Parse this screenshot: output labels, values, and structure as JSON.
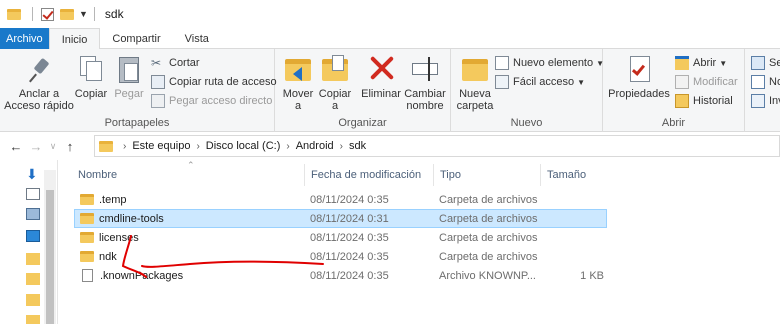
{
  "window": {
    "title": "sdk"
  },
  "tabs": [
    {
      "label": "Archivo"
    },
    {
      "label": "Inicio"
    },
    {
      "label": "Compartir"
    },
    {
      "label": "Vista"
    }
  ],
  "ribbon": {
    "portapapeles": {
      "label": "Portapapeles",
      "anclar": "Anclar a\nAcceso rápido",
      "anclar_l1": "Anclar a",
      "anclar_l2": "Acceso rápido",
      "copiar": "Copiar",
      "pegar": "Pegar",
      "cortar": "Cortar",
      "copiar_ruta": "Copiar ruta de acceso",
      "pegar_acceso": "Pegar acceso directo"
    },
    "organizar": {
      "label": "Organizar",
      "mover_l1": "Mover",
      "mover_l2": "a",
      "copiar_l1": "Copiar",
      "copiar_l2": "a",
      "eliminar": "Eliminar",
      "cambiar_l1": "Cambiar",
      "cambiar_l2": "nombre"
    },
    "nuevo": {
      "label": "Nuevo",
      "nueva_l1": "Nueva",
      "nueva_l2": "carpeta",
      "nuevo_elemento": "Nuevo elemento",
      "facil_acceso": "Fácil acceso"
    },
    "abrir": {
      "label": "Abrir",
      "propiedades": "Propiedades",
      "abrir": "Abrir",
      "modificar": "Modificar",
      "historial": "Historial"
    },
    "seleccionar": {
      "sel1": "Sel",
      "sel2": "No",
      "sel3": "Inv"
    }
  },
  "address": {
    "crumbs": [
      "Este equipo",
      "Disco local (C:)",
      "Android",
      "sdk"
    ]
  },
  "columns": {
    "name": "Nombre",
    "date": "Fecha de modificación",
    "type": "Tipo",
    "size": "Tamaño"
  },
  "files": [
    {
      "name": ".temp",
      "date": "08/11/2024 0:35",
      "type": "Carpeta de archivos",
      "size": "",
      "kind": "folder"
    },
    {
      "name": "cmdline-tools",
      "date": "08/11/2024 0:31",
      "type": "Carpeta de archivos",
      "size": "",
      "kind": "folder",
      "selected": true
    },
    {
      "name": "licenses",
      "date": "08/11/2024 0:35",
      "type": "Carpeta de archivos",
      "size": "",
      "kind": "folder"
    },
    {
      "name": "ndk",
      "date": "08/11/2024 0:35",
      "type": "Carpeta de archivos",
      "size": "",
      "kind": "folder"
    },
    {
      "name": ".knownPackages",
      "date": "08/11/2024 0:35",
      "type": "Archivo KNOWNP...",
      "size": "1 KB",
      "kind": "file"
    }
  ],
  "colors": {
    "file_tab": "#1979ca",
    "selection": "#cce8ff",
    "folder": "#f4c95d",
    "annotation": "#e00000"
  },
  "icons": [
    "folder-icon",
    "checkmark-icon",
    "pin-icon",
    "copy-icon",
    "paste-icon",
    "scissors-icon",
    "move-icon",
    "delete-icon",
    "rename-icon",
    "new-folder-icon",
    "properties-icon",
    "history-icon",
    "back-arrow-icon",
    "forward-arrow-icon",
    "up-arrow-icon"
  ]
}
